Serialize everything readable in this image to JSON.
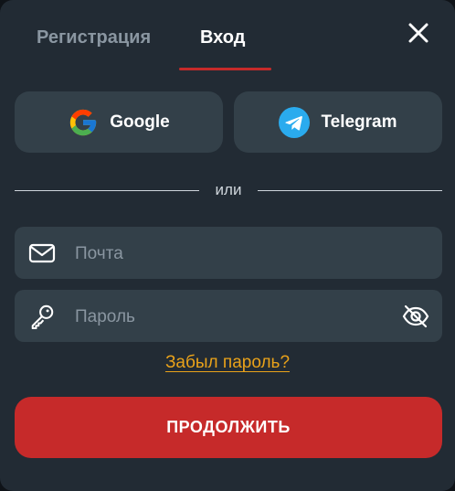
{
  "tabs": {
    "register_label": "Регистрация",
    "login_label": "Вход",
    "active": "login"
  },
  "social": {
    "google_label": "Google",
    "telegram_label": "Telegram"
  },
  "divider": {
    "text": "или"
  },
  "fields": {
    "email_placeholder": "Почта",
    "email_value": "",
    "password_placeholder": "Пароль",
    "password_value": ""
  },
  "forgot_label": "Забыл пароль?",
  "submit_label": "ПРОДОЛЖИТЬ",
  "colors": {
    "background": "#222b34",
    "surface": "#334049",
    "accent": "#c62a2a",
    "link": "#e9a21a",
    "muted_text": "#8a96a1"
  },
  "icons": {
    "close": "close-icon",
    "google": "google-icon",
    "telegram": "telegram-icon",
    "email": "envelope-icon",
    "password": "key-icon",
    "visibility": "eye-off-icon"
  }
}
